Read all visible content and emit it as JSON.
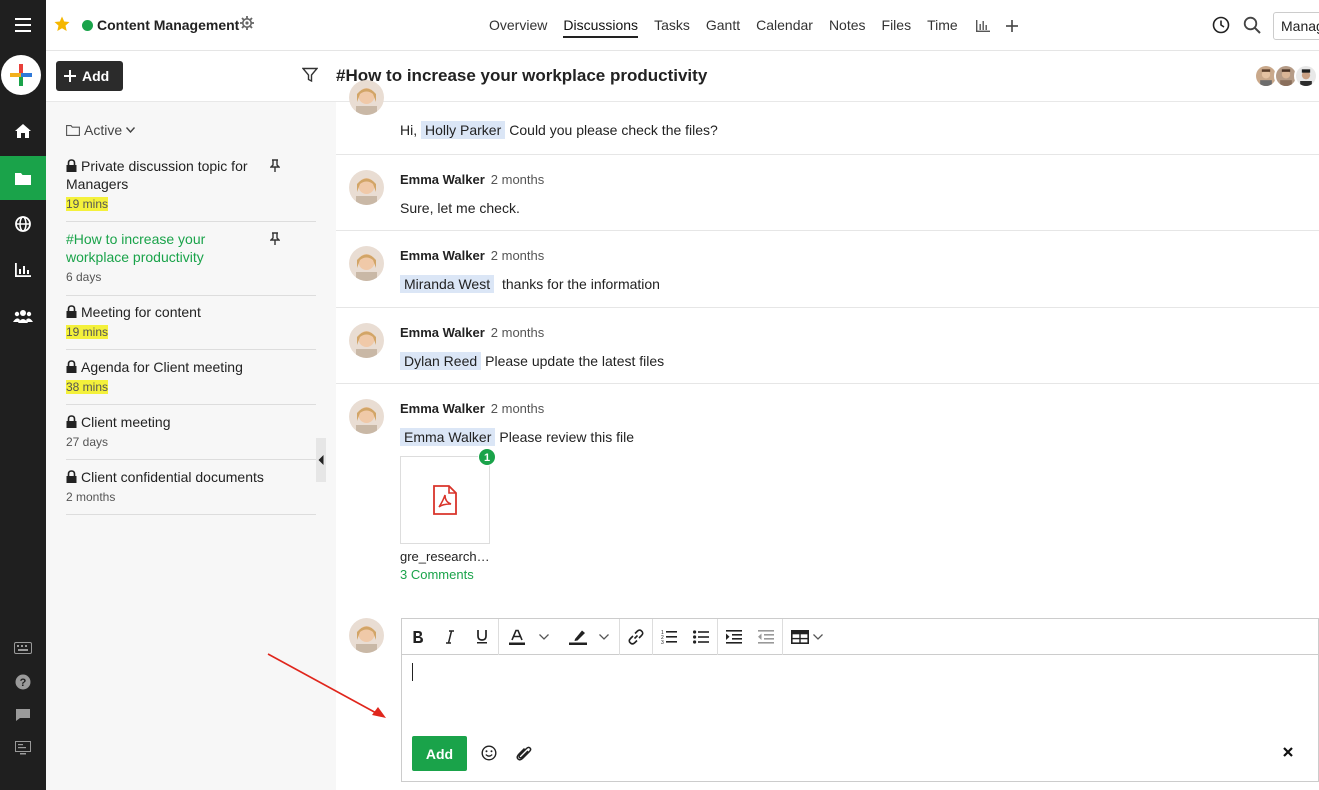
{
  "topbar": {
    "project_name": "Content Management",
    "tabs": [
      {
        "label": "Overview"
      },
      {
        "label": "Discussions"
      },
      {
        "label": "Tasks"
      },
      {
        "label": "Gantt"
      },
      {
        "label": "Calendar"
      },
      {
        "label": "Notes"
      },
      {
        "label": "Files"
      },
      {
        "label": "Time"
      }
    ],
    "active_tab": "Discussions",
    "manage_label": "Manage"
  },
  "subbar": {
    "add_label": "Add",
    "topic_title": "#How to increase your workplace productivity"
  },
  "sidebar": {
    "filter_label": "Active",
    "topics": [
      {
        "name": "Private discussion topic for Managers",
        "time": "19 mins",
        "locked": true,
        "pinned": true,
        "highlight": true
      },
      {
        "name": "#How to increase your workplace productivity",
        "time": "6 days",
        "locked": false,
        "pinned": true,
        "highlight": false,
        "active": true
      },
      {
        "name": "Meeting for content",
        "time": "19 mins",
        "locked": true,
        "highlight": true
      },
      {
        "name": "Agenda for Client meeting",
        "time": "38 mins",
        "locked": true,
        "highlight": true
      },
      {
        "name": "Client meeting",
        "time": "27 days",
        "locked": true,
        "highlight": false
      },
      {
        "name": "Client confidential documents",
        "time": "2 months",
        "locked": true,
        "highlight": false
      }
    ]
  },
  "messages": [
    {
      "greeting": "Hi,",
      "mention": "Holly Parker",
      "text": "Could you please check the files?"
    },
    {
      "author": "Emma Walker",
      "ago": "2 months",
      "text": "Sure, let me check."
    },
    {
      "author": "Emma Walker",
      "ago": "2 months",
      "mention": "Miranda West",
      "text": "thanks for the information"
    },
    {
      "author": "Emma Walker",
      "ago": "2 months",
      "mention": "Dylan Reed",
      "text": "Please update the latest files"
    },
    {
      "author": "Emma Walker",
      "ago": "2 months",
      "mention": "Emma Walker",
      "text": "Please review this file",
      "attachment": {
        "name": "gre_research…",
        "badge": "1",
        "comments": "3 Comments"
      }
    }
  ],
  "editor": {
    "add_label": "Add",
    "close_label": "×"
  },
  "colors": {
    "accent": "#1aa34a",
    "rail": "#1f1f1f",
    "highlight": "#f4f13b",
    "mention": "#dbe6f6"
  }
}
